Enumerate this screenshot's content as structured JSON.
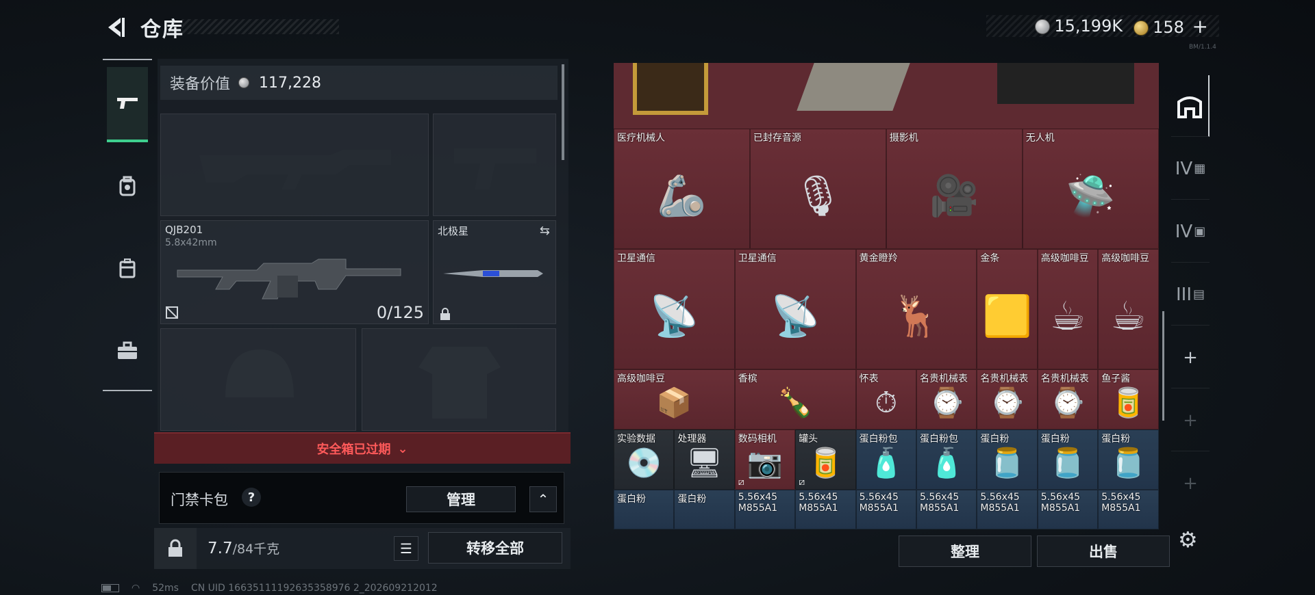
{
  "header": {
    "title": "仓库",
    "currency_silver": "15,199K",
    "currency_gold": "158",
    "plus": "+",
    "tiny_code": "BM/1.1.4"
  },
  "left_rail": {
    "items": [
      "gun-icon",
      "backpack-icon",
      "vest-icon",
      "case-icon"
    ]
  },
  "equipment": {
    "value_label": "装备价值",
    "value": "117,228",
    "primary_weapon": {
      "name": "QJB201",
      "caliber": "5.8x42mm",
      "ammo": "0/125"
    },
    "melee": {
      "name": "北极星"
    },
    "safe_status": "安全箱已过期",
    "keycard_label": "门禁卡包",
    "help": "?",
    "manage": "管理",
    "expand": "⌃",
    "weight_current": "7.7",
    "weight_max": "/84千克",
    "transfer_all": "转移全部"
  },
  "inventory": {
    "rows": [
      [
        {
          "label": "医疗机械人",
          "icon": "🦾",
          "color": "red",
          "w": 2
        },
        {
          "label": "已封存音源",
          "icon": "🎙",
          "color": "red",
          "w": 2
        },
        {
          "label": "摄影机",
          "icon": "🎥",
          "color": "red",
          "w": 2
        },
        {
          "label": "无人机",
          "icon": "🛸",
          "color": "red",
          "w": 2
        }
      ]
    ],
    "row2": [
      {
        "label": "卫星通信",
        "icon": "📡"
      },
      {
        "label": "卫星通信",
        "icon": "📡"
      },
      {
        "label": "黄金瞪羚",
        "icon": "🦌"
      },
      {
        "label": "金条",
        "icon": "🟨"
      },
      {
        "label": "高级咖啡豆",
        "icon": "☕"
      },
      {
        "label": "高级咖啡豆",
        "icon": "☕"
      }
    ],
    "row3": [
      {
        "label": "高级咖啡豆",
        "icon": "📦"
      },
      {
        "label": "香槟",
        "icon": "🍾"
      },
      {
        "label": "怀表",
        "icon": "⏱"
      },
      {
        "label": "名贵机械表",
        "icon": "⌚"
      },
      {
        "label": "名贵机械表",
        "icon": "⌚"
      },
      {
        "label": "名贵机械表",
        "icon": "⌚"
      },
      {
        "label": "鱼子酱",
        "icon": "🥫"
      }
    ],
    "row4": [
      {
        "label": "实验数据",
        "icon": "💿",
        "color": "grey"
      },
      {
        "label": "处理器",
        "icon": "🖥",
        "color": "grey"
      },
      {
        "label": "数码相机",
        "icon": "📷",
        "color": "red"
      },
      {
        "label": "罐头",
        "icon": "🥫",
        "color": "grey"
      },
      {
        "label": "蛋白粉包",
        "icon": "🧴",
        "color": "blue"
      },
      {
        "label": "蛋白粉包",
        "icon": "🧴",
        "color": "blue"
      },
      {
        "label": "蛋白粉",
        "icon": "🫙",
        "color": "blue"
      },
      {
        "label": "蛋白粉",
        "icon": "🫙",
        "color": "blue"
      },
      {
        "label": "蛋白粉",
        "icon": "🫙",
        "color": "blue"
      }
    ],
    "row5": [
      {
        "label": "蛋白粉",
        "sub": "",
        "color": "blue"
      },
      {
        "label": "蛋白粉",
        "sub": "",
        "color": "blue"
      },
      {
        "label": "5.56x45",
        "sub": "M855A1",
        "color": "blue"
      },
      {
        "label": "5.56x45",
        "sub": "M855A1",
        "color": "blue"
      },
      {
        "label": "5.56x45",
        "sub": "M855A1",
        "color": "blue"
      },
      {
        "label": "5.56x45",
        "sub": "M855A1",
        "color": "blue"
      },
      {
        "label": "5.56x45",
        "sub": "M855A1",
        "color": "blue"
      },
      {
        "label": "5.56x45",
        "sub": "M855A1",
        "color": "blue"
      },
      {
        "label": "5.56x45",
        "sub": "M855A1",
        "color": "blue"
      }
    ],
    "sort": "整理",
    "sell": "出售"
  },
  "right_rail": {
    "items": [
      "IV",
      "IV",
      "III",
      "+",
      "+",
      "+"
    ]
  },
  "status": {
    "ping": "52ms",
    "uid": "CN UID 16635111192635358976 2_202609212012"
  }
}
